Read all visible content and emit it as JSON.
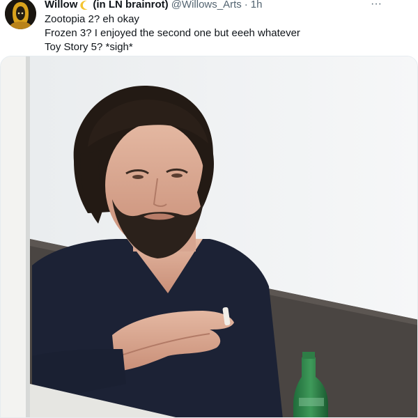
{
  "tweet": {
    "display_name": "Willow",
    "name_suffix": "(in LN brainrot)",
    "handle": "@Willows_Arts",
    "separator": "·",
    "time": "1h",
    "more_label": "···",
    "lines": [
      "Zootopia 2? eh okay",
      "Frozen 3? I enjoyed the second one but eeeh whatever",
      "Toy Story 5? *sigh*"
    ]
  },
  "icons": {
    "moon": "crescent-moon-icon",
    "more": "more-options-icon"
  },
  "colors": {
    "text_primary": "#0f1419",
    "text_secondary": "#536471",
    "moon": "#f4c430"
  }
}
